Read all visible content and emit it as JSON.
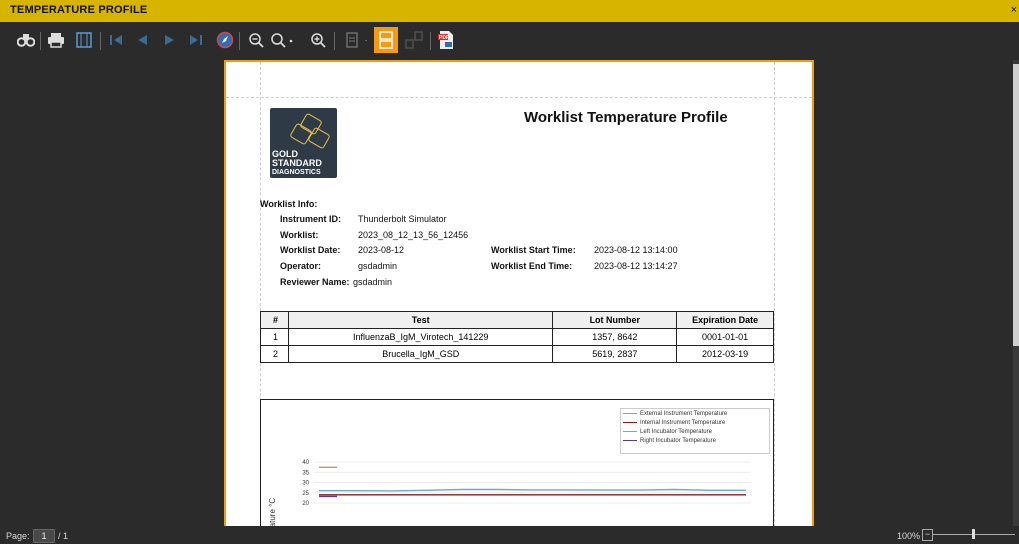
{
  "window": {
    "title": "TEMPERATURE PROFILE",
    "close": "×"
  },
  "toolbar": {
    "icons": [
      "binoculars-icon",
      "print-icon",
      "page-setup-icon",
      "first-page-icon",
      "prev-page-icon",
      "next-page-icon",
      "last-page-icon",
      "navigate-icon",
      "zoom-out-icon",
      "zoom-dropdown-icon",
      "zoom-in-icon",
      "single-page-icon",
      "multi-page-icon",
      "watermark-icon",
      "export-pdf-icon"
    ]
  },
  "report": {
    "logo": {
      "line1": "GOLD",
      "line2": "STANDARD",
      "line3": "DIAGNOSTICS"
    },
    "title": "Worklist Temperature Profile",
    "section_label": "Worklist Info:",
    "info": {
      "instrument_id_label": "Instrument ID:",
      "instrument_id": "Thunderbolt Simulator",
      "worklist_label": "Worklist:",
      "worklist": "2023_08_12_13_56_12456",
      "worklist_date_label": "Worklist Date:",
      "worklist_date": "2023-08-12",
      "operator_label": "Operator:",
      "operator": "gsdadmin",
      "reviewer_label": "Reviewer Name:",
      "reviewer": "gsdadmin",
      "start_time_label": "Worklist Start Time:",
      "start_time": "2023-08-12 13:14:00",
      "end_time_label": "Worklist End Time:",
      "end_time": "2023-08-12 13:14:27"
    },
    "table": {
      "headers": [
        "#",
        "Test",
        "Lot Number",
        "Expiration Date"
      ],
      "rows": [
        [
          "1",
          "InfluenzaB_IgM_Virotech_141229",
          "1357, 8642",
          "0001-01-01"
        ],
        [
          "2",
          "Brucella_IgM_GSD",
          "5619, 2837",
          "2012-03-19"
        ]
      ]
    }
  },
  "chart_data": {
    "type": "line",
    "ylabel": "rature °C",
    "y_ticks": [
      "40",
      "35",
      "30",
      "25",
      "20"
    ],
    "grid": true,
    "legend_position": "top-right",
    "series": [
      {
        "name": "External Instrument Temperature",
        "color": "#6fa8c8",
        "values": [
          26,
          26,
          25.9,
          26.2,
          26.6,
          26.6,
          26.4,
          26.4,
          26.3,
          26.3,
          26.6,
          26.2,
          26.2
        ]
      },
      {
        "name": "Internal Instrument Temperature",
        "color": "#8b1a1a",
        "values": [
          24,
          24,
          24,
          24,
          24,
          24,
          24,
          24,
          24,
          24,
          24,
          24,
          24
        ]
      },
      {
        "name": "Left Incubator Temperature",
        "color": "#b59a6a",
        "values": [
          37.4,
          37.4,
          null,
          null,
          null,
          null,
          null,
          null,
          null,
          null,
          null,
          null,
          null
        ]
      },
      {
        "name": "Right Incubator Temperature",
        "color": "#5a3a8c",
        "values": [
          23.2,
          23.2,
          null,
          null,
          null,
          null,
          null,
          null,
          null,
          null,
          null,
          null,
          null
        ]
      }
    ]
  },
  "status": {
    "page_label": "Page:",
    "page_current": "1",
    "page_total": "/ 1",
    "zoom": "100%",
    "zoom_level_percent": 100,
    "zoom_minus": "−"
  }
}
